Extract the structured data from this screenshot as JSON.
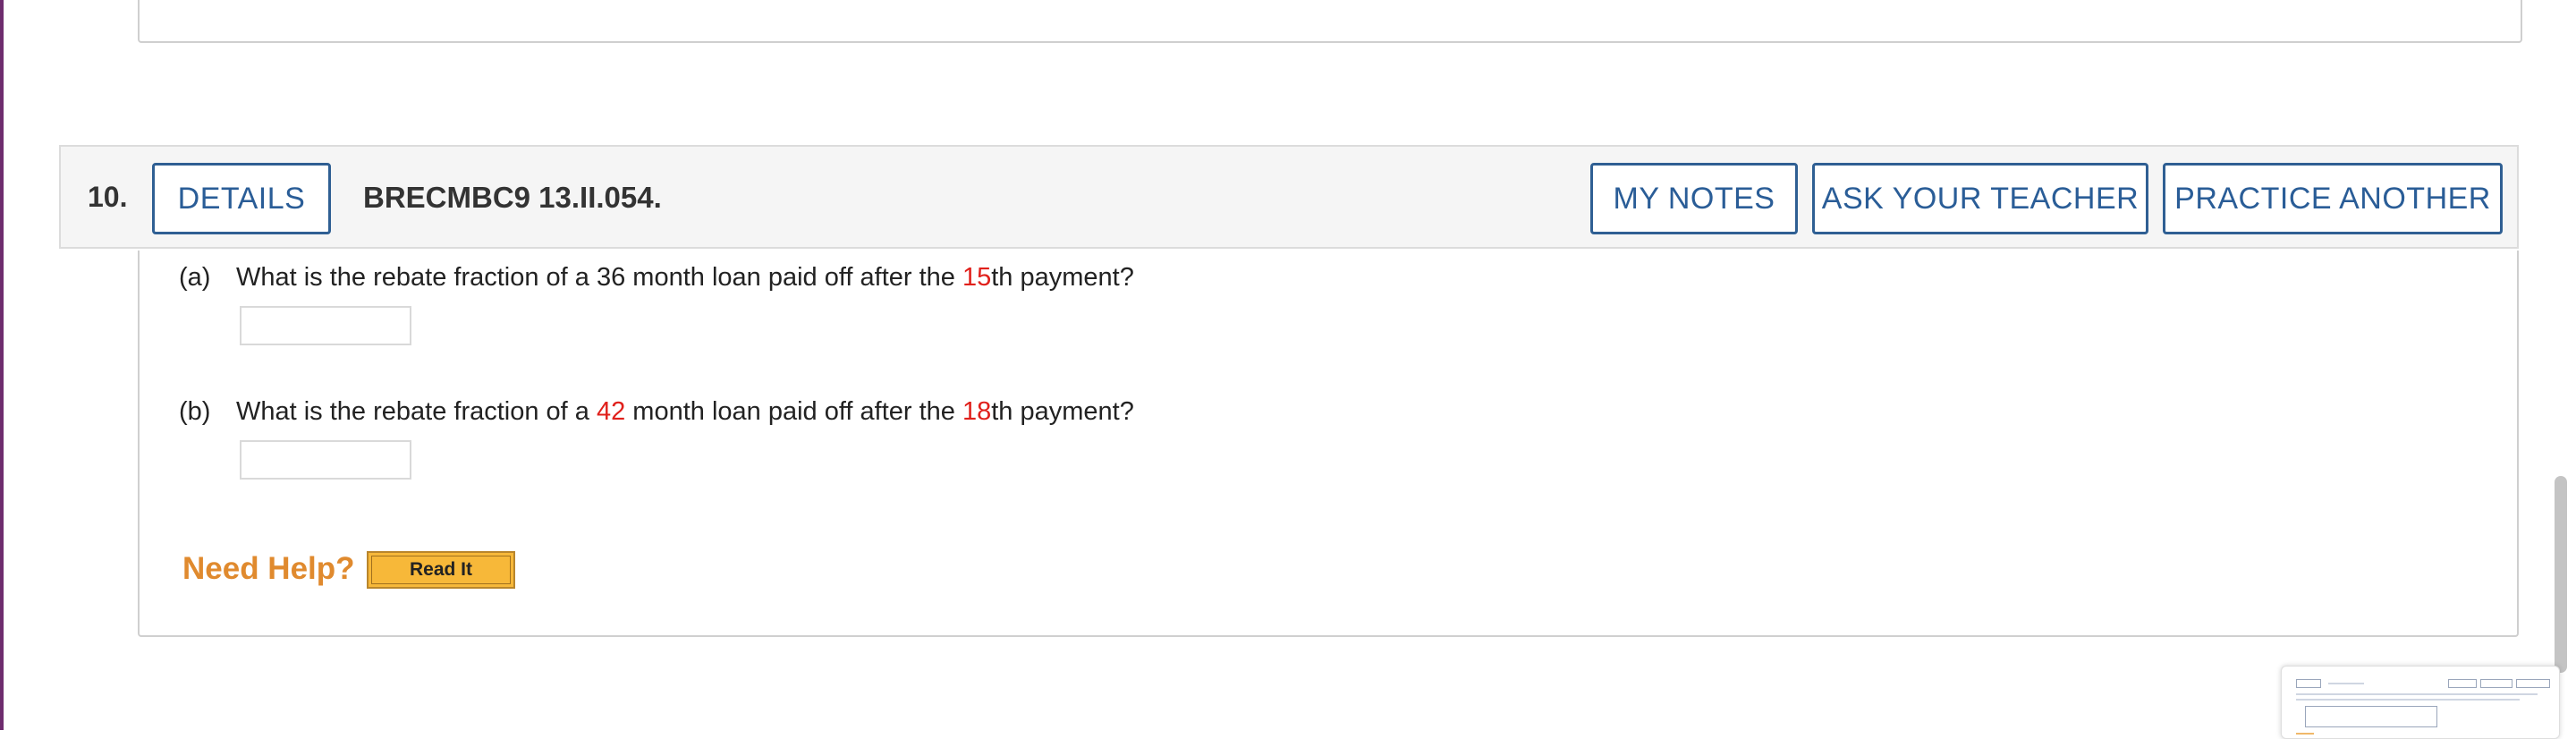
{
  "question": {
    "number": "10.",
    "details_label": "DETAILS",
    "code": "BRECMBC9 13.II.054.",
    "my_notes_label": "MY NOTES",
    "ask_teacher_label": "ASK YOUR TEACHER",
    "practice_another_label": "PRACTICE ANOTHER"
  },
  "parts": [
    {
      "letter": "(a)",
      "t1": "What is the rebate fraction of a ",
      "n1": "36",
      "t2": " month loan paid off after the ",
      "n2": "15",
      "t3": "th payment?",
      "answer": ""
    },
    {
      "letter": "(b)",
      "t1": "What is the rebate fraction of a ",
      "n1": "42",
      "t2": " month loan paid off after the ",
      "n2": "18",
      "t3": "th payment?",
      "answer": ""
    }
  ],
  "help": {
    "need_help": "Need Help?",
    "read_it": "Read It"
  },
  "colors": {
    "accent": "#2a5d97",
    "variable_red": "#e0201b",
    "help_orange": "#e08a2e",
    "read_it_yellow": "#f7b839"
  }
}
